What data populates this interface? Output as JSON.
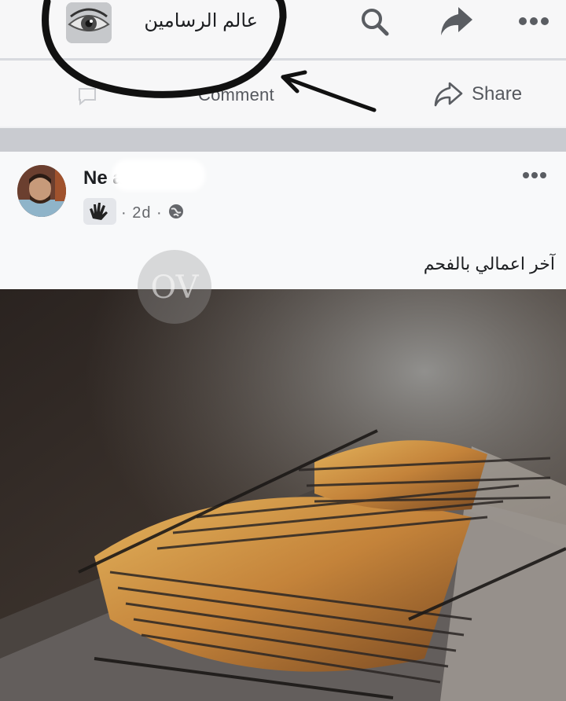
{
  "header": {
    "page_name": "عالم الرسامين",
    "icons": [
      "search-icon",
      "share-arrow-icon",
      "more-icon"
    ]
  },
  "actions": {
    "comment_label": "Comment",
    "share_label": "Share"
  },
  "post": {
    "author": "Ne            as",
    "time": "2d",
    "caption": "آخر اعمالي بالفحم"
  },
  "watermark": {
    "text": "OV"
  },
  "colors": {
    "topbar_bg": "#f7f7f8",
    "separator": "#c9cbd0",
    "icon": "#5a5d62",
    "circle_annotation": "#111111"
  }
}
